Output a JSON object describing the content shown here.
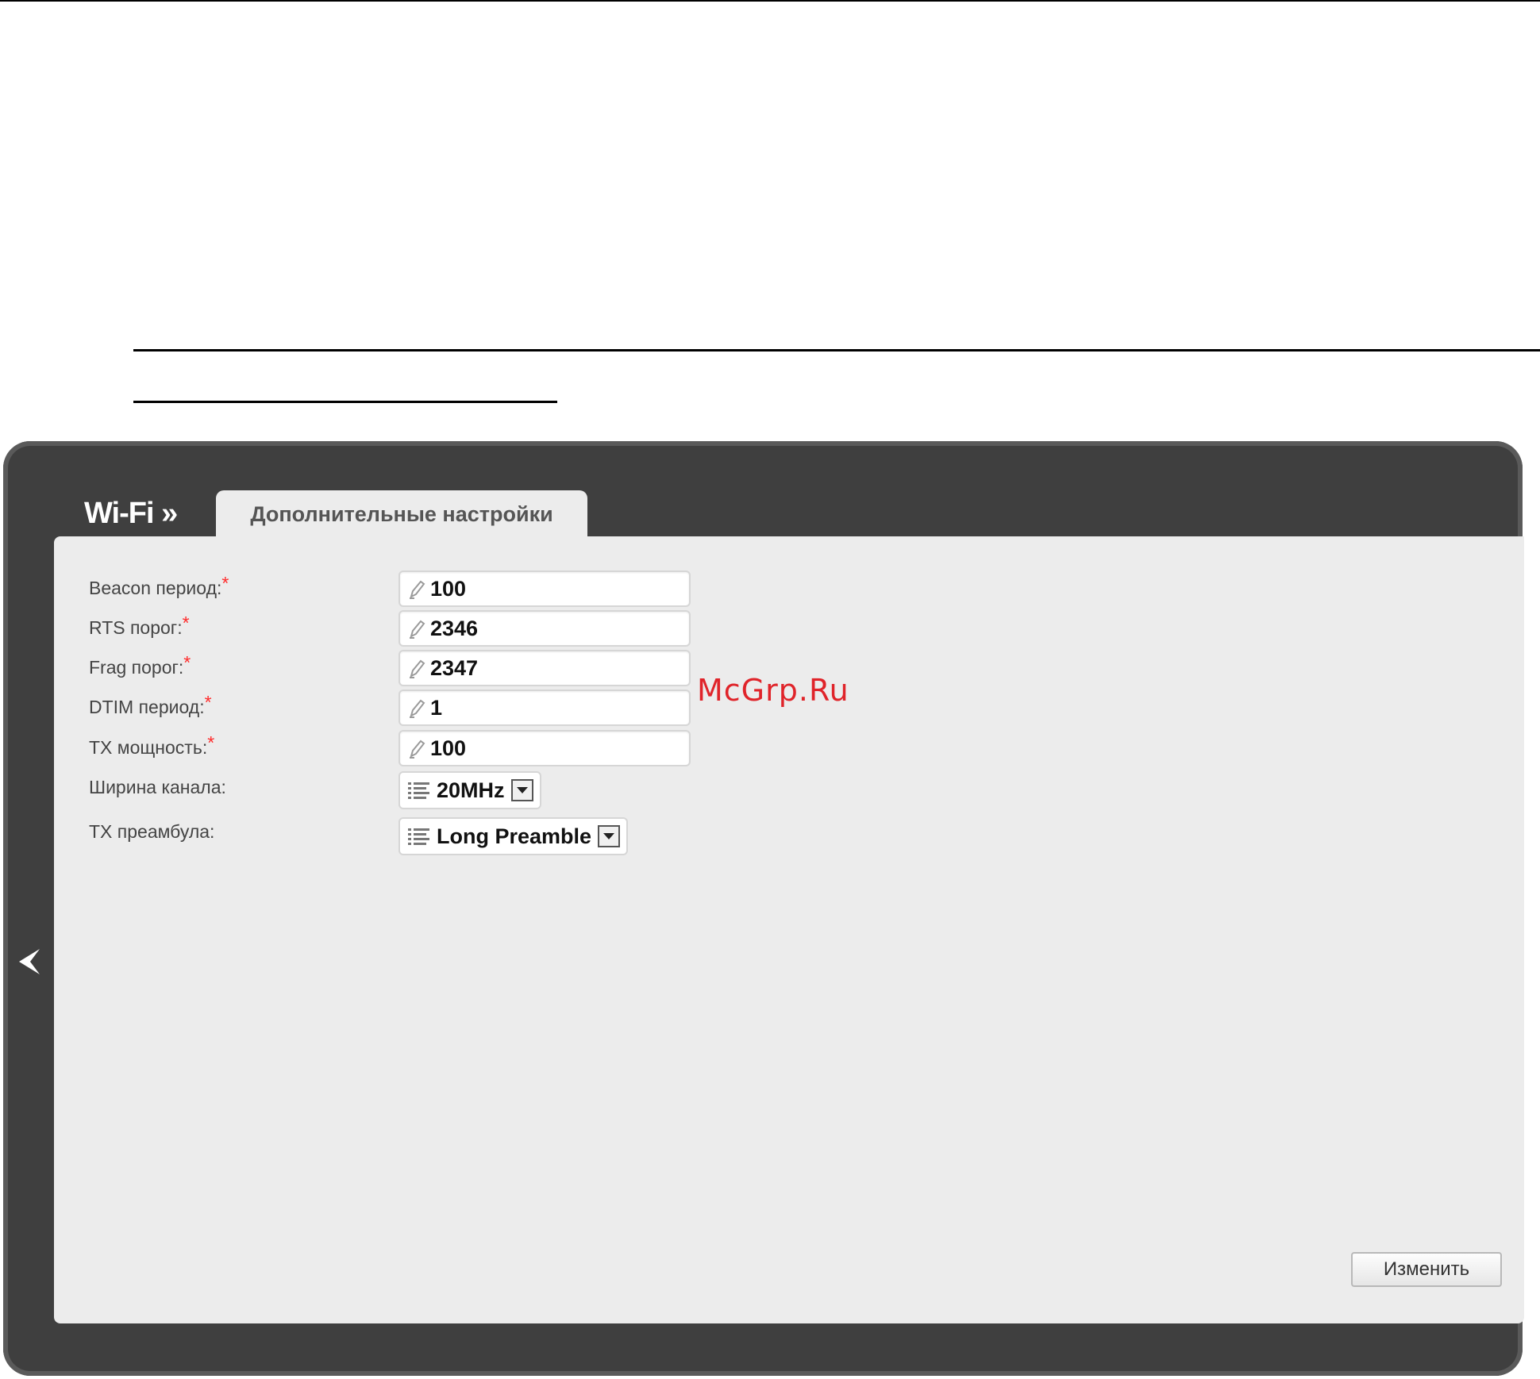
{
  "header": {
    "breadcrumb_root": "Wi-Fi »",
    "active_tab": "Дополнительные настройки"
  },
  "form": {
    "fields": [
      {
        "label": "Beacon период:",
        "required": "*",
        "value": "100"
      },
      {
        "label": "RTS порог:",
        "required": "*",
        "value": "2346"
      },
      {
        "label": "Frag порог:",
        "required": "*",
        "value": "2347"
      },
      {
        "label": "DTIM период:",
        "required": "*",
        "value": "1"
      },
      {
        "label": "TX мощность:",
        "required": "*",
        "value": "100"
      }
    ],
    "selects": [
      {
        "label": "Ширина канала:",
        "value": "20MHz"
      },
      {
        "label": "TX преамбула:",
        "value": "Long Preamble"
      }
    ]
  },
  "actions": {
    "apply_label": "Изменить"
  },
  "watermark": "McGrp.Ru",
  "colors": {
    "frame": "#3f3f3f",
    "panel": "#ececec",
    "required_mark": "#ff2b2b",
    "watermark": "#e0242a"
  },
  "icons": {
    "back": "chevron-left-icon",
    "field": "pencil-icon",
    "select": "list-icon",
    "dropdown": "chevron-down-icon"
  }
}
